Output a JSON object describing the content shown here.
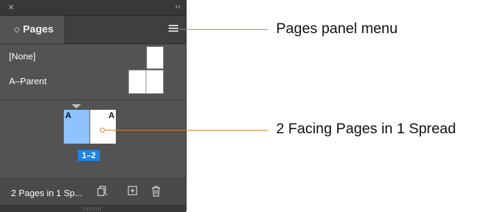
{
  "panel": {
    "close_glyph": "×",
    "collapse_glyph": "‹‹",
    "tab": {
      "label": "Pages",
      "icon": "◇"
    },
    "menu_icon": "hamburger-menu-icon",
    "parents": [
      {
        "label": "[None]"
      },
      {
        "label": "A–Parent"
      }
    ],
    "spread": {
      "left_parent": "A",
      "right_parent": "A",
      "page_range": "1–2",
      "left_page_color": "#8ec3ff",
      "badge_color": "#1f84e3"
    },
    "footer": {
      "status": "2 Pages in 1 Sp...",
      "buttons": [
        "page-size-icon",
        "new-page-icon",
        "delete-page-icon"
      ]
    }
  },
  "callouts": {
    "menu": "Pages panel menu",
    "spread": "2 Facing Pages in 1 Spread",
    "line_color": "#e07a2b"
  }
}
